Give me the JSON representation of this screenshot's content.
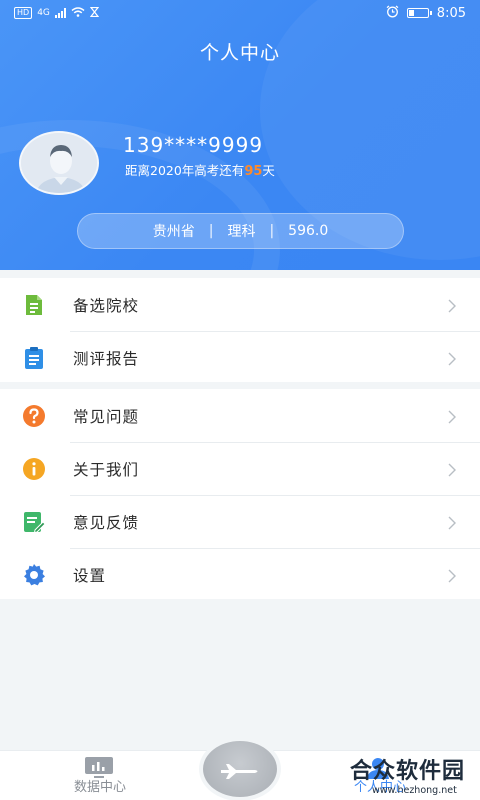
{
  "status": {
    "left_indicators": [
      "HD",
      "4G"
    ],
    "alarm_icon": "alarm-icon",
    "battery_level": 0.3,
    "time": "8:05"
  },
  "header": {
    "title": "个人中心",
    "phone": "139****9999",
    "countdown_prefix": "距离2020年高考还有",
    "countdown_days": "95",
    "countdown_suffix": "天",
    "province": "贵州省",
    "subject": "理科",
    "score": "596.0",
    "separator": "|"
  },
  "menu_group_1": [
    {
      "label": "备选院校",
      "icon": "school-list-icon",
      "color": "#6dbb3c"
    },
    {
      "label": "测评报告",
      "icon": "report-clipboard-icon",
      "color": "#2f8fe6"
    }
  ],
  "menu_group_2": [
    {
      "label": "常见问题",
      "icon": "question-icon",
      "color": "#f47a2d"
    },
    {
      "label": "关于我们",
      "icon": "info-icon",
      "color": "#f5a623"
    },
    {
      "label": "意见反馈",
      "icon": "feedback-edit-icon",
      "color": "#3fb76a"
    },
    {
      "label": "设置",
      "icon": "gear-icon",
      "color": "#3b7fe0"
    }
  ],
  "tabbar": {
    "data_center": "数据中心",
    "center_action_icon": "airplane-icon",
    "profile": "个人中心"
  },
  "watermark": {
    "brand": "合众软件园",
    "url": "www.hezhong.net"
  },
  "colors": {
    "primary": "#3b87f3",
    "highlight": "#ff8a2a"
  }
}
